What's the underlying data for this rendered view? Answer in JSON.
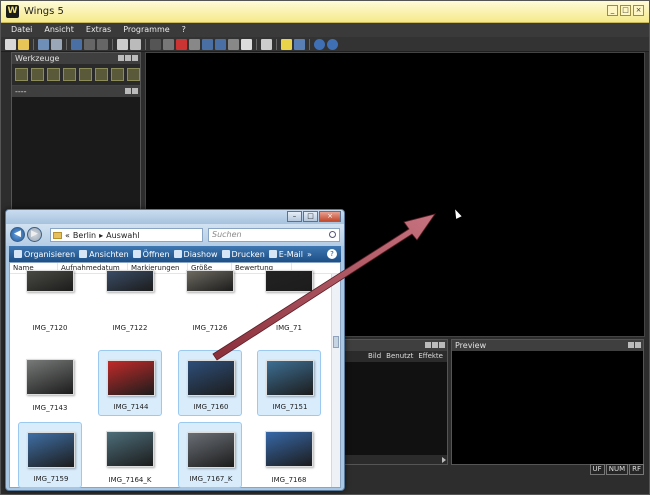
{
  "wings": {
    "title": "Wings 5",
    "app_icon": "W",
    "window_controls": [
      "_",
      "□",
      "×"
    ],
    "menu": [
      "Datei",
      "Ansicht",
      "Extras",
      "Programme",
      "?"
    ],
    "toolbar_icons": [
      "new-icon",
      "open-icon",
      "save-icon",
      "print-icon",
      "undo-icon",
      "redo-icon",
      "cut-icon",
      "copy-icon",
      "text-icon",
      "xy-icon",
      "record-icon",
      "play-icon",
      "monitor-icon",
      "warning-icon",
      "info-icon",
      "help-icon"
    ],
    "tools_panel": {
      "title": "Werkzeuge",
      "tool_icons": [
        "select-icon",
        "hand-icon",
        "zoom-icon",
        "crop-icon",
        "move-icon",
        "rotate-icon",
        "star-icon",
        "split-icon"
      ]
    },
    "sub_panel_title": "----",
    "bottom_columns": [
      "Bild",
      "Benutzt",
      "Effekte"
    ],
    "preview_title": "Preview",
    "status": [
      "UF",
      "NUM",
      "RF"
    ]
  },
  "explorer": {
    "breadcrumb_prefix": "«",
    "breadcrumb": [
      "Berlin",
      "Auswahl"
    ],
    "search_placeholder": "Suchen",
    "commands": [
      {
        "label": "Organisieren",
        "icon": "organize-icon"
      },
      {
        "label": "Ansichten",
        "icon": "views-icon"
      },
      {
        "label": "Öffnen",
        "icon": "open-icon"
      },
      {
        "label": "Diashow",
        "icon": "slideshow-icon"
      },
      {
        "label": "Drucken",
        "icon": "print-icon"
      },
      {
        "label": "E-Mail",
        "icon": "email-icon"
      }
    ],
    "more": "»",
    "help": "?",
    "columns": [
      "Name",
      "Aufnahmedatum",
      "Markierungen",
      "Größe",
      "Bewertung"
    ],
    "files": [
      {
        "name": "IMG_7120",
        "selected": false,
        "color": "#4a4a44"
      },
      {
        "name": "IMG_7122",
        "selected": false,
        "color": "#3a4c66"
      },
      {
        "name": "IMG_7126",
        "selected": false,
        "color": "#6d6a60"
      },
      {
        "name": "IMG_71",
        "selected": false,
        "color": "#222222"
      },
      {
        "name": "IMG_7143",
        "selected": false,
        "color": "#777a78"
      },
      {
        "name": "IMG_7144",
        "selected": true,
        "color": "#c22a2a"
      },
      {
        "name": "IMG_7160",
        "selected": true,
        "color": "#2e4f7a"
      },
      {
        "name": "IMG_7151",
        "selected": true,
        "color": "#3d6f94"
      },
      {
        "name": "IMG_7159",
        "selected": true,
        "color": "#3f6fa5"
      },
      {
        "name": "IMG_7164_K",
        "selected": false,
        "color": "#4d6e7a"
      },
      {
        "name": "IMG_7167_K",
        "selected": true,
        "color": "#6a6f76"
      },
      {
        "name": "IMG_7168",
        "selected": false,
        "color": "#3768a8"
      }
    ]
  },
  "colors": {
    "arrow": "#b04a56",
    "selection": "#d9ecfb",
    "wings_title": "#f6e98b"
  }
}
